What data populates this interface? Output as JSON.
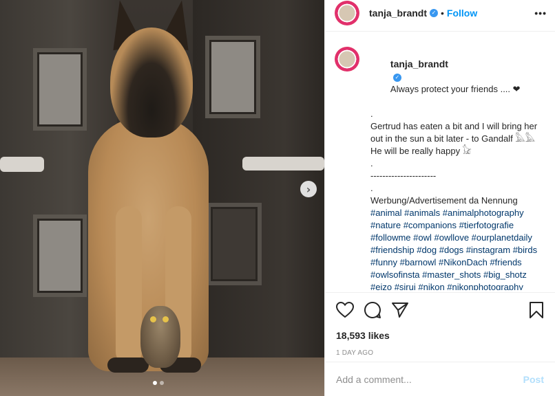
{
  "post": {
    "username": "tanja_brandt",
    "verified_badge": "✓",
    "header_separator": "•",
    "follow_label": "Follow",
    "more_icon": "•••"
  },
  "caption": {
    "username": "tanja_brandt",
    "first_line": "Always protect your friends .... ❤",
    "lines": [
      ".",
      "Gertrud has eaten a bit and I will bring her out in the sun a bit later - to Gandalf 𓅓𓅓",
      "He will be really happy 𓃠",
      ".",
      "----------------------",
      ".",
      "Werbung/Advertisement da Nennung"
    ],
    "hashtags": "#animal #animals #animalphotography #nature #companions #tierfotografie #followme #owl #owllove #ourplanetdaily #friendship #dog #dogs #instagram #birds #funny #barnowl #NikonDach #friends #owlsofinsta #master_shots #big_shotz #eizo #sirui #nikon #nikonphotography"
  },
  "photo": {
    "next_icon": "›",
    "carousel_total": 2,
    "carousel_active": 1
  },
  "engagement": {
    "likes": "18,593 likes",
    "time": "1 DAY AGO"
  },
  "comment": {
    "placeholder": "Add a comment...",
    "post_label": "Post"
  }
}
